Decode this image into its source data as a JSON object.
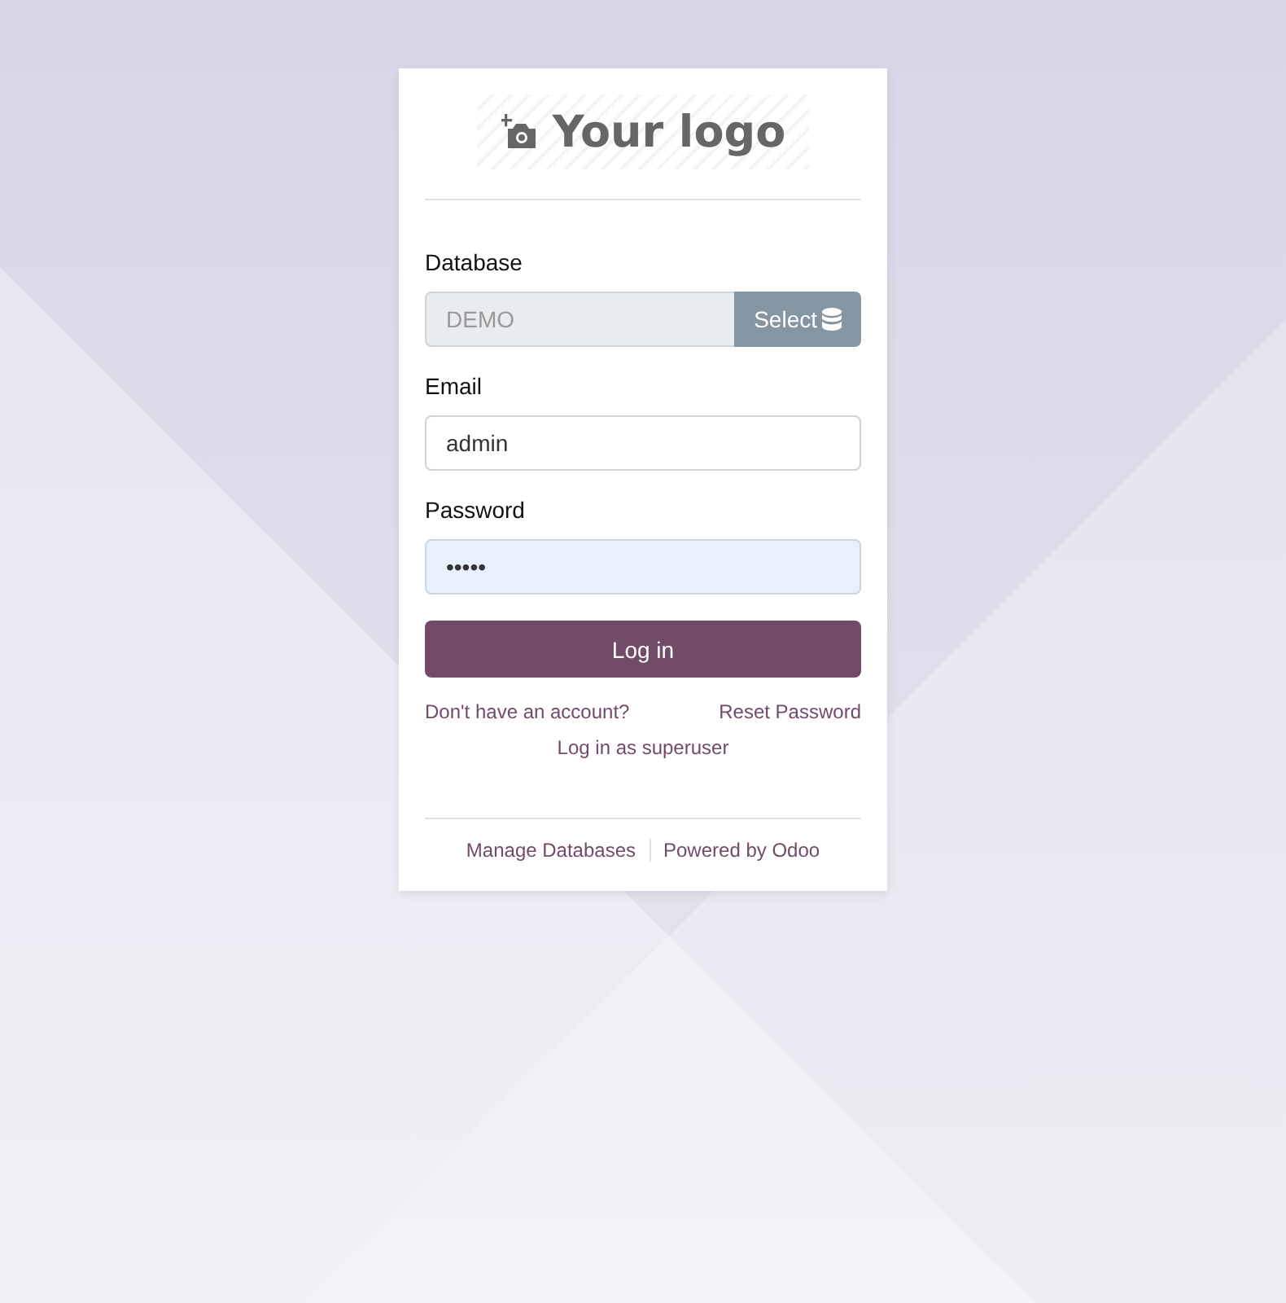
{
  "logo": {
    "text": "Your logo"
  },
  "fields": [
    {
      "label": "Database",
      "value": "DEMO",
      "readonly": true,
      "autofilled": false,
      "button": "Select"
    },
    {
      "label": "Email",
      "value": "admin",
      "readonly": false,
      "autofilled": false
    },
    {
      "label": "Password",
      "value": "•••••",
      "readonly": false,
      "autofilled": true
    }
  ],
  "submit": "Log in",
  "links": {
    "signup": "Don't have an account?",
    "reset": "Reset Password",
    "superuser": "Log in as superuser"
  },
  "footer": [
    "Manage Databases",
    "Powered by Odoo"
  ]
}
